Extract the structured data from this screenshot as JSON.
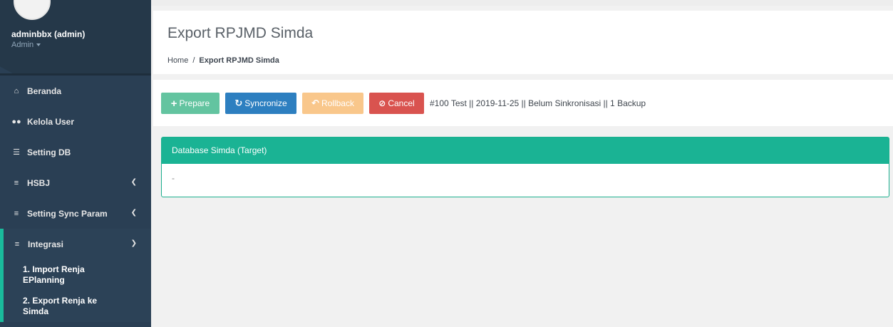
{
  "user": {
    "name": "adminbbx (admin)",
    "role": "Admin"
  },
  "sidebar": {
    "items": [
      {
        "label": "Beranda",
        "icon": "home-icon"
      },
      {
        "label": "Kelola User",
        "icon": "users-icon"
      },
      {
        "label": "Setting DB",
        "icon": "database-icon"
      },
      {
        "label": "HSBJ",
        "icon": "list-icon"
      },
      {
        "label": "Setting Sync Param",
        "icon": "list-icon"
      },
      {
        "label": "Integrasi",
        "icon": "list-icon"
      }
    ],
    "subitems": [
      {
        "label": "1. Import Renja EPlanning"
      },
      {
        "label": "2. Export Renja ke Simda"
      }
    ]
  },
  "page": {
    "title": "Export RPJMD Simda",
    "breadcrumb_home": "Home",
    "breadcrumb_sep": "/",
    "breadcrumb_current": "Export RPJMD Simda"
  },
  "toolbar": {
    "prepare": "Prepare",
    "sync": "Syncronize",
    "rollback": "Rollback",
    "cancel": "Cancel",
    "status": "#100 Test || 2019-11-25 || Belum Sinkronisasi || 1 Backup"
  },
  "panel": {
    "title": "Database Simda (Target)",
    "body": "-"
  },
  "colors": {
    "sidebar": "#2a3f54",
    "accent": "#1ab394",
    "prepare": "#63c4a0",
    "sync": "#2d7fc0",
    "rollback": "#f9c78b",
    "cancel": "#d9534f"
  }
}
